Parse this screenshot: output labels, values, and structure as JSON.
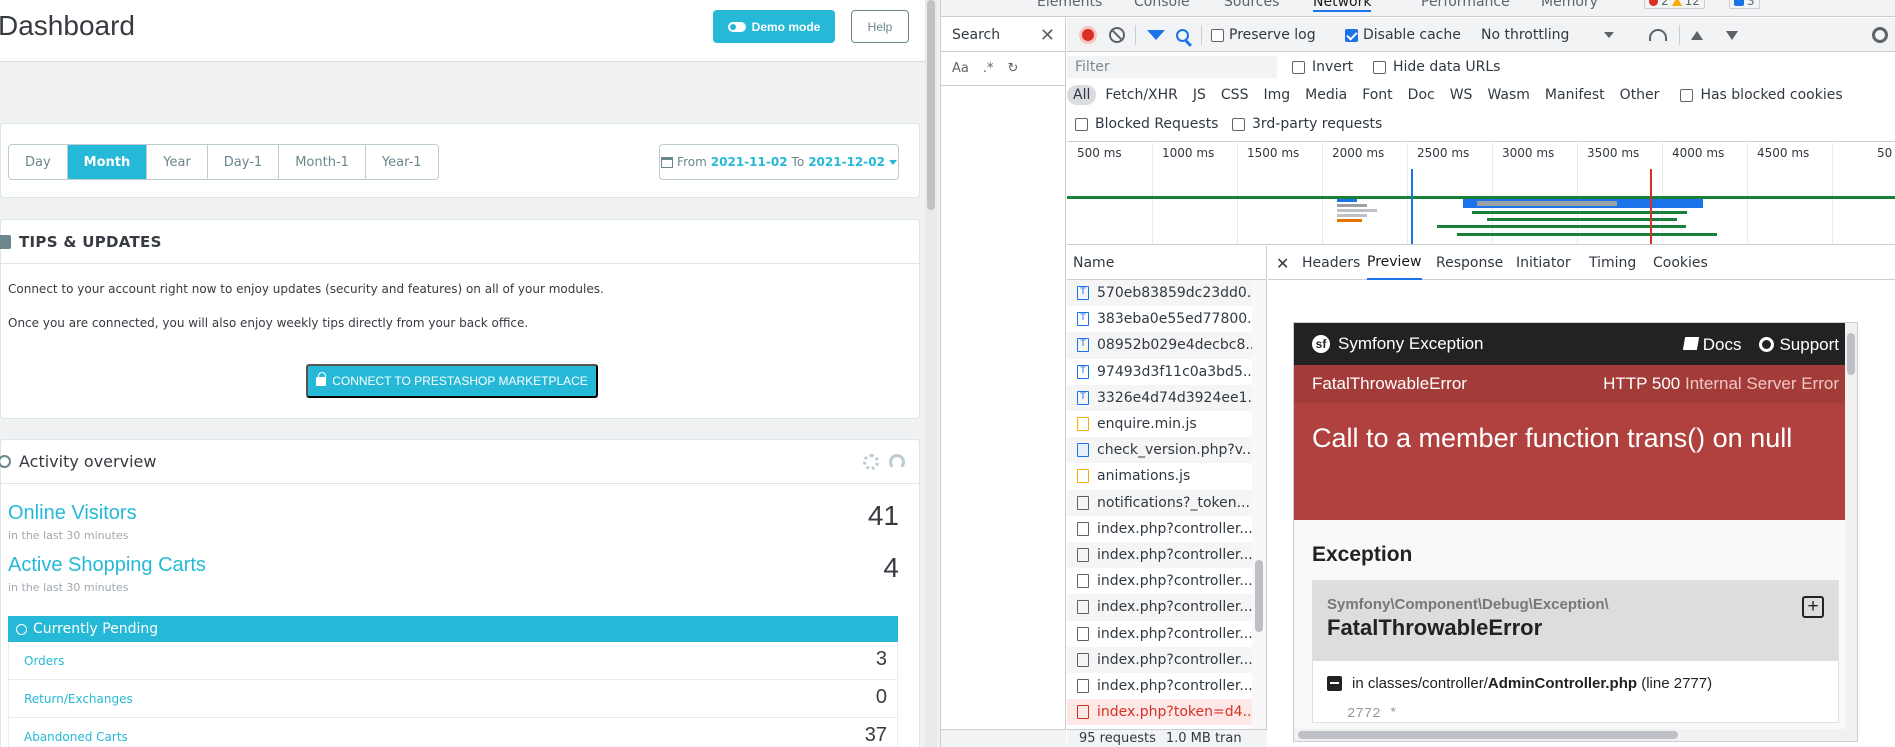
{
  "dashboard": {
    "title": "Dashboard",
    "demo_mode_label": "Demo mode",
    "help_label": "Help",
    "periods": [
      "Day",
      "Month",
      "Year",
      "Day-1",
      "Month-1",
      "Year-1"
    ],
    "active_period": "Month",
    "date_range": {
      "from_label": "From",
      "from": "2021-11-02",
      "to_label": "To",
      "to": "2021-12-02"
    },
    "tips": {
      "title": "TIPS & UPDATES",
      "line1": "Connect to your account right now to enjoy updates (security and features) on all of your modules.",
      "line2": "Once you are connected, you will also enjoy weekly tips directly from your back office.",
      "connect_label": "CONNECT TO PRESTASHOP MARKETPLACE"
    },
    "activity": {
      "title": "Activity overview",
      "online_visitors_label": "Online Visitors",
      "online_visitors_sub": "in the last 30 minutes",
      "online_visitors_value": "41",
      "active_carts_label": "Active Shopping Carts",
      "active_carts_sub": "in the last 30 minutes",
      "active_carts_value": "4",
      "pending_title": "Currently Pending",
      "pending": [
        {
          "label": "Orders",
          "value": "3"
        },
        {
          "label": "Return/Exchanges",
          "value": "0"
        },
        {
          "label": "Abandoned Carts",
          "value": "37"
        }
      ]
    }
  },
  "devtools": {
    "tabs": [
      "Elements",
      "Console",
      "Sources",
      "Network",
      "Performance",
      "Memory"
    ],
    "active_tab": "Network",
    "badges": {
      "errors": "2",
      "warnings": "12",
      "info": "3"
    },
    "search_pane": {
      "title": "Search",
      "case_label": "Aa",
      "regex_label": ".*"
    },
    "toolbar": {
      "preserve_log": "Preserve log",
      "disable_cache": "Disable cache",
      "throttling": "No throttling"
    },
    "filter": {
      "placeholder": "Filter",
      "invert": "Invert",
      "hide_data_urls": "Hide data URLs",
      "types": [
        "All",
        "Fetch/XHR",
        "JS",
        "CSS",
        "Img",
        "Media",
        "Font",
        "Doc",
        "WS",
        "Wasm",
        "Manifest",
        "Other"
      ],
      "has_blocked_cookies": "Has blocked cookies",
      "blocked_requests": "Blocked Requests",
      "third_party": "3rd-party requests"
    },
    "timeline_ticks": [
      "500 ms",
      "1000 ms",
      "1500 ms",
      "2000 ms",
      "2500 ms",
      "3000 ms",
      "3500 ms",
      "4000 ms",
      "4500 ms",
      "50"
    ],
    "name_header": "Name",
    "requests": [
      {
        "name": "570eb83859dc23dd0...",
        "kind": "font"
      },
      {
        "name": "383eba0e55ed77800...",
        "kind": "font"
      },
      {
        "name": "08952b029e4decbc8...",
        "kind": "font"
      },
      {
        "name": "97493d3f11c0a3bd5...",
        "kind": "font"
      },
      {
        "name": "3326e4d74d3924ee1...",
        "kind": "font"
      },
      {
        "name": "enquire.min.js",
        "kind": "js"
      },
      {
        "name": "check_version.php?v...",
        "kind": "doc"
      },
      {
        "name": "animations.js",
        "kind": "js"
      },
      {
        "name": "notifications?_token...",
        "kind": "other"
      },
      {
        "name": "index.php?controller...",
        "kind": "other"
      },
      {
        "name": "index.php?controller...",
        "kind": "other"
      },
      {
        "name": "index.php?controller...",
        "kind": "other"
      },
      {
        "name": "index.php?controller...",
        "kind": "other"
      },
      {
        "name": "index.php?controller...",
        "kind": "other"
      },
      {
        "name": "index.php?controller...",
        "kind": "other"
      },
      {
        "name": "index.php?controller...",
        "kind": "other"
      },
      {
        "name": "index.php?token=d4...",
        "kind": "err"
      }
    ],
    "status": {
      "requests": "95 requests",
      "transferred": "1.0 MB tran"
    },
    "detail_tabs": [
      "Headers",
      "Preview",
      "Response",
      "Initiator",
      "Timing",
      "Cookies"
    ],
    "active_detail_tab": "Preview",
    "preview": {
      "brand": "Symfony Exception",
      "docs": "Docs",
      "support": "Support",
      "error_type": "FatalThrowableError",
      "http_code": "HTTP 500",
      "http_text": "Internal Server Error",
      "message": "Call to a member function trans() on null",
      "exception_title": "Exception",
      "namespace": "Symfony\\Component\\Debug\\Exception\\",
      "class_name": "FatalThrowableError",
      "loc_in": "in classes/controller/",
      "loc_file": "AdminController.php",
      "loc_line": "(line 2777)",
      "code_line": "2772          *"
    }
  }
}
